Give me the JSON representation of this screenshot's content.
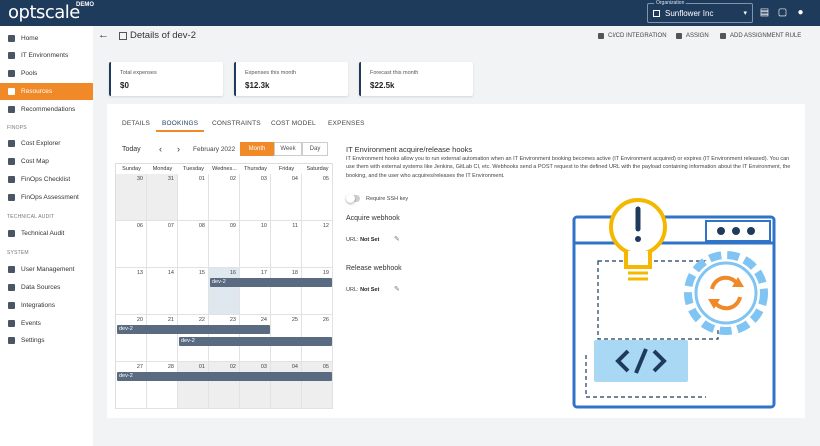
{
  "app": {
    "logo": "optscale",
    "logo_badge": "DEMO"
  },
  "topbar": {
    "org_label": "Organization",
    "org_value": "Sunflower Inc"
  },
  "sidebar": {
    "items": [
      {
        "label": "Home"
      },
      {
        "label": "IT Environments"
      },
      {
        "label": "Pools"
      },
      {
        "label": "Resources"
      },
      {
        "label": "Recommendations"
      }
    ],
    "finops_section": "FINOPS",
    "finops_items": [
      {
        "label": "Cost Explorer"
      },
      {
        "label": "Cost Map"
      },
      {
        "label": "FinOps Checklist"
      },
      {
        "label": "FinOps Assessment"
      }
    ],
    "audit_section": "TECHNICAL AUDIT",
    "audit_items": [
      {
        "label": "Technical Audit"
      }
    ],
    "system_section": "SYSTEM",
    "system_items": [
      {
        "label": "User Management"
      },
      {
        "label": "Data Sources"
      },
      {
        "label": "Integrations"
      },
      {
        "label": "Events"
      },
      {
        "label": "Settings"
      }
    ]
  },
  "header": {
    "title": "Details of dev-2",
    "actions": [
      "CI/CD INTEGRATION",
      "ASSIGN",
      "ADD ASSIGNMENT RULE"
    ]
  },
  "cards": [
    {
      "label": "Total expenses",
      "value": "$0"
    },
    {
      "label": "Expenses this month",
      "value": "$12.3k"
    },
    {
      "label": "Forecast this month",
      "value": "$22.5k"
    }
  ],
  "tabs": [
    "DETAILS",
    "BOOKINGS",
    "CONSTRAINTS",
    "COST MODEL",
    "EXPENSES"
  ],
  "calendar": {
    "today_label": "Today",
    "month_label": "February 2022",
    "views": [
      "Month",
      "Week",
      "Day"
    ],
    "weekdays": [
      "Sunday",
      "Monday",
      "Tuesday",
      "Wednes...",
      "Thursday",
      "Friday",
      "Saturday"
    ],
    "weeks": [
      [
        "30",
        "31",
        "01",
        "02",
        "03",
        "04",
        "05"
      ],
      [
        "06",
        "07",
        "08",
        "09",
        "10",
        "11",
        "12"
      ],
      [
        "13",
        "14",
        "15",
        "16",
        "17",
        "18",
        "19"
      ],
      [
        "20",
        "21",
        "22",
        "23",
        "24",
        "25",
        "26"
      ],
      [
        "27",
        "28",
        "01",
        "02",
        "03",
        "04",
        "05"
      ]
    ],
    "event_label": "dev-2"
  },
  "hooks": {
    "title": "IT Environment acquire/release hooks",
    "description": "IT Environment hooks allow you to run external automation when an IT Environment booking becomes active (IT Environment acquired) or expires (IT Environment released). You can use them with external systems like Jenkins, GitLab CI, etc. Webhooks send a POST request to the defined URL with the payload containing information about the IT Environment, the booking, and the user who acquires/releases the IT Environment.",
    "ssh_label": "Require SSH key",
    "acquire_title": "Acquire webhook",
    "release_title": "Release webhook",
    "url_label": "URL:",
    "url_value": "Not Set"
  },
  "colors": {
    "accent": "#f08a28",
    "navy": "#1f3b5c",
    "event": "#5a6a80",
    "illustration_blue": "#2f74c9"
  }
}
